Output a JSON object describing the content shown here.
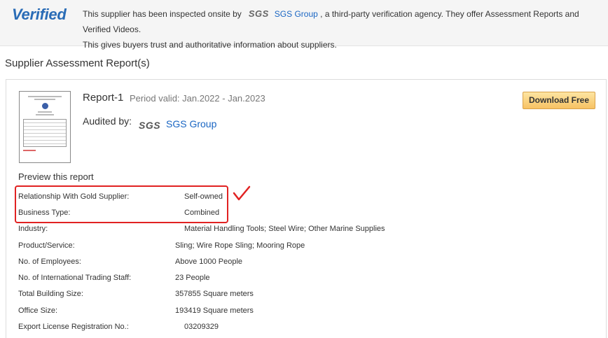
{
  "verified": {
    "logo": "Verified",
    "text_before": "This supplier has been inspected onsite by",
    "sgs_mark": "SGS",
    "agency_link": "SGS Group",
    "text_after": ", a third-party verification agency. They offer Assessment Reports and Verified Videos.",
    "text_line2": "This gives buyers trust and authoritative information about suppliers."
  },
  "section_title": "Supplier Assessment Report(s)",
  "report": {
    "name": "Report-1",
    "period": "Period valid: Jan.2022 - Jan.2023",
    "audited_label": "Audited by:",
    "sgs_mark": "SGS",
    "auditor": "SGS Group",
    "download_label": "Download Free",
    "preview_title": "Preview this report",
    "rows": [
      {
        "label": "Relationship With Gold Supplier:",
        "value": "Self-owned"
      },
      {
        "label": "Business Type:",
        "value": "Combined"
      },
      {
        "label": "Industry:",
        "value": "Material Handling Tools; Steel Wire; Other Marine Supplies"
      },
      {
        "label": "Product/Service:",
        "value": "Sling; Wire Rope Sling; Mooring Rope"
      },
      {
        "label": "No. of Employees:",
        "value": "Above 1000 People"
      },
      {
        "label": "No. of International Trading Staff:",
        "value": "23 People"
      },
      {
        "label": "Total Building Size:",
        "value": "357855 Square meters"
      },
      {
        "label": "Office Size:",
        "value": "193419 Square meters"
      },
      {
        "label": "Export License Registration No.:",
        "value": "03209329"
      }
    ]
  },
  "colors": {
    "link": "#1a66c3",
    "annotation": "#e12222",
    "button_bg": "#f7c263"
  },
  "icons": {
    "check": "checkmark-icon"
  }
}
